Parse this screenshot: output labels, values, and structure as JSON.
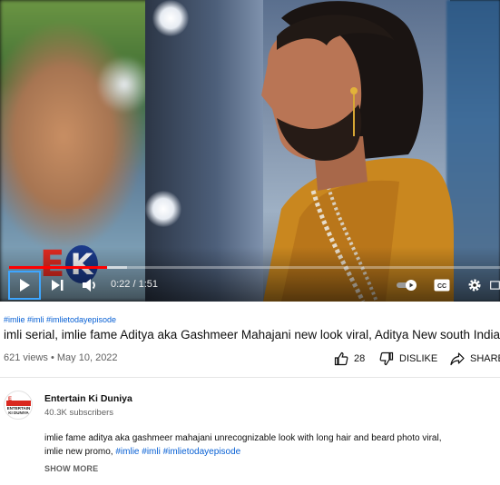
{
  "player": {
    "time_current": "0:22",
    "time_separator": " / ",
    "time_total": "1:51",
    "progress_played_fraction": 0.2,
    "progress_buffered_fraction": 0.24,
    "overlay_logo": {
      "letter_e": "E",
      "letter_k": "K"
    },
    "colors": {
      "played": "#ff0000",
      "focus_ring": "#3ea6ff"
    },
    "icons": [
      "play-icon",
      "next-icon",
      "volume-icon",
      "autoplay-toggle-icon",
      "captions-icon",
      "settings-icon",
      "miniplayer-icon"
    ]
  },
  "video": {
    "hashtags": "#imlie #imli #imlietodayepisode",
    "title": "imli serial, imlie fame Aditya aka Gashmeer Mahajani new look viral, Aditya New south Indian",
    "views": "621 views",
    "date": "May 10, 2022",
    "stats_separator": " • "
  },
  "actions": {
    "like_count": "28",
    "dislike_label": "DISLIKE",
    "share_label": "SHARE"
  },
  "channel": {
    "name": "Entertain Ki Duniya",
    "subscribers": "40.3K subscribers",
    "avatar_text": "ENTERTAIN KI DUNIYA",
    "avatar_mark": "E"
  },
  "description": {
    "text_line1": "imlie fame aditya aka gashmeer mahajani unrecognizable look with long hair and beard photo viral,",
    "text_line2_prefix": "imlie new promo, ",
    "tags": "#imlie #imli #imlietodayepisode",
    "show_more": "SHOW MORE"
  },
  "colors": {
    "link": "#065fd4",
    "secondary_text": "#606060",
    "primary_text": "#0f0f0f",
    "divider": "#e5e5e5"
  }
}
